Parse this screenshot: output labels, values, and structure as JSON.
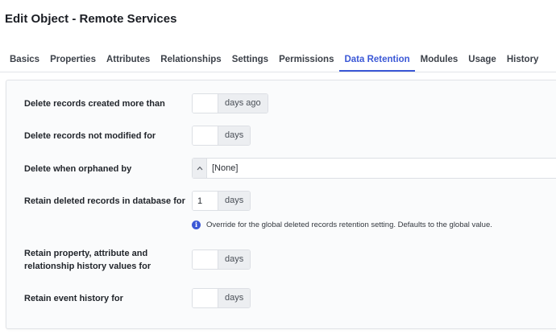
{
  "page_title": "Edit Object - Remote Services",
  "tabs": [
    {
      "label": "Basics"
    },
    {
      "label": "Properties"
    },
    {
      "label": "Attributes"
    },
    {
      "label": "Relationships"
    },
    {
      "label": "Settings"
    },
    {
      "label": "Permissions"
    },
    {
      "label": "Data Retention",
      "active": true
    },
    {
      "label": "Modules"
    },
    {
      "label": "Usage"
    },
    {
      "label": "History"
    }
  ],
  "form": {
    "delete_created": {
      "label": "Delete records created more than",
      "value": "",
      "unit": "days ago"
    },
    "delete_not_modified": {
      "label": "Delete records not modified for",
      "value": "",
      "unit": "days"
    },
    "delete_orphaned": {
      "label": "Delete when orphaned by",
      "value": "[None]",
      "icon": "chevron-up-icon"
    },
    "retain_deleted": {
      "label": "Retain deleted records in database for",
      "value": "1",
      "unit": "days",
      "info_icon": "info-icon",
      "info": "Override for the global deleted records retention setting. Defaults to the global value."
    },
    "retain_history": {
      "label_line1": "Retain property, attribute and",
      "label_line2": "relationship history values for",
      "value": "",
      "unit": "days"
    },
    "retain_events": {
      "label": "Retain event history for",
      "value": "",
      "unit": "days"
    }
  },
  "colors": {
    "accent": "#3b58d6",
    "panel_bg": "#fafbfc",
    "unit_bg": "#eceef1"
  }
}
